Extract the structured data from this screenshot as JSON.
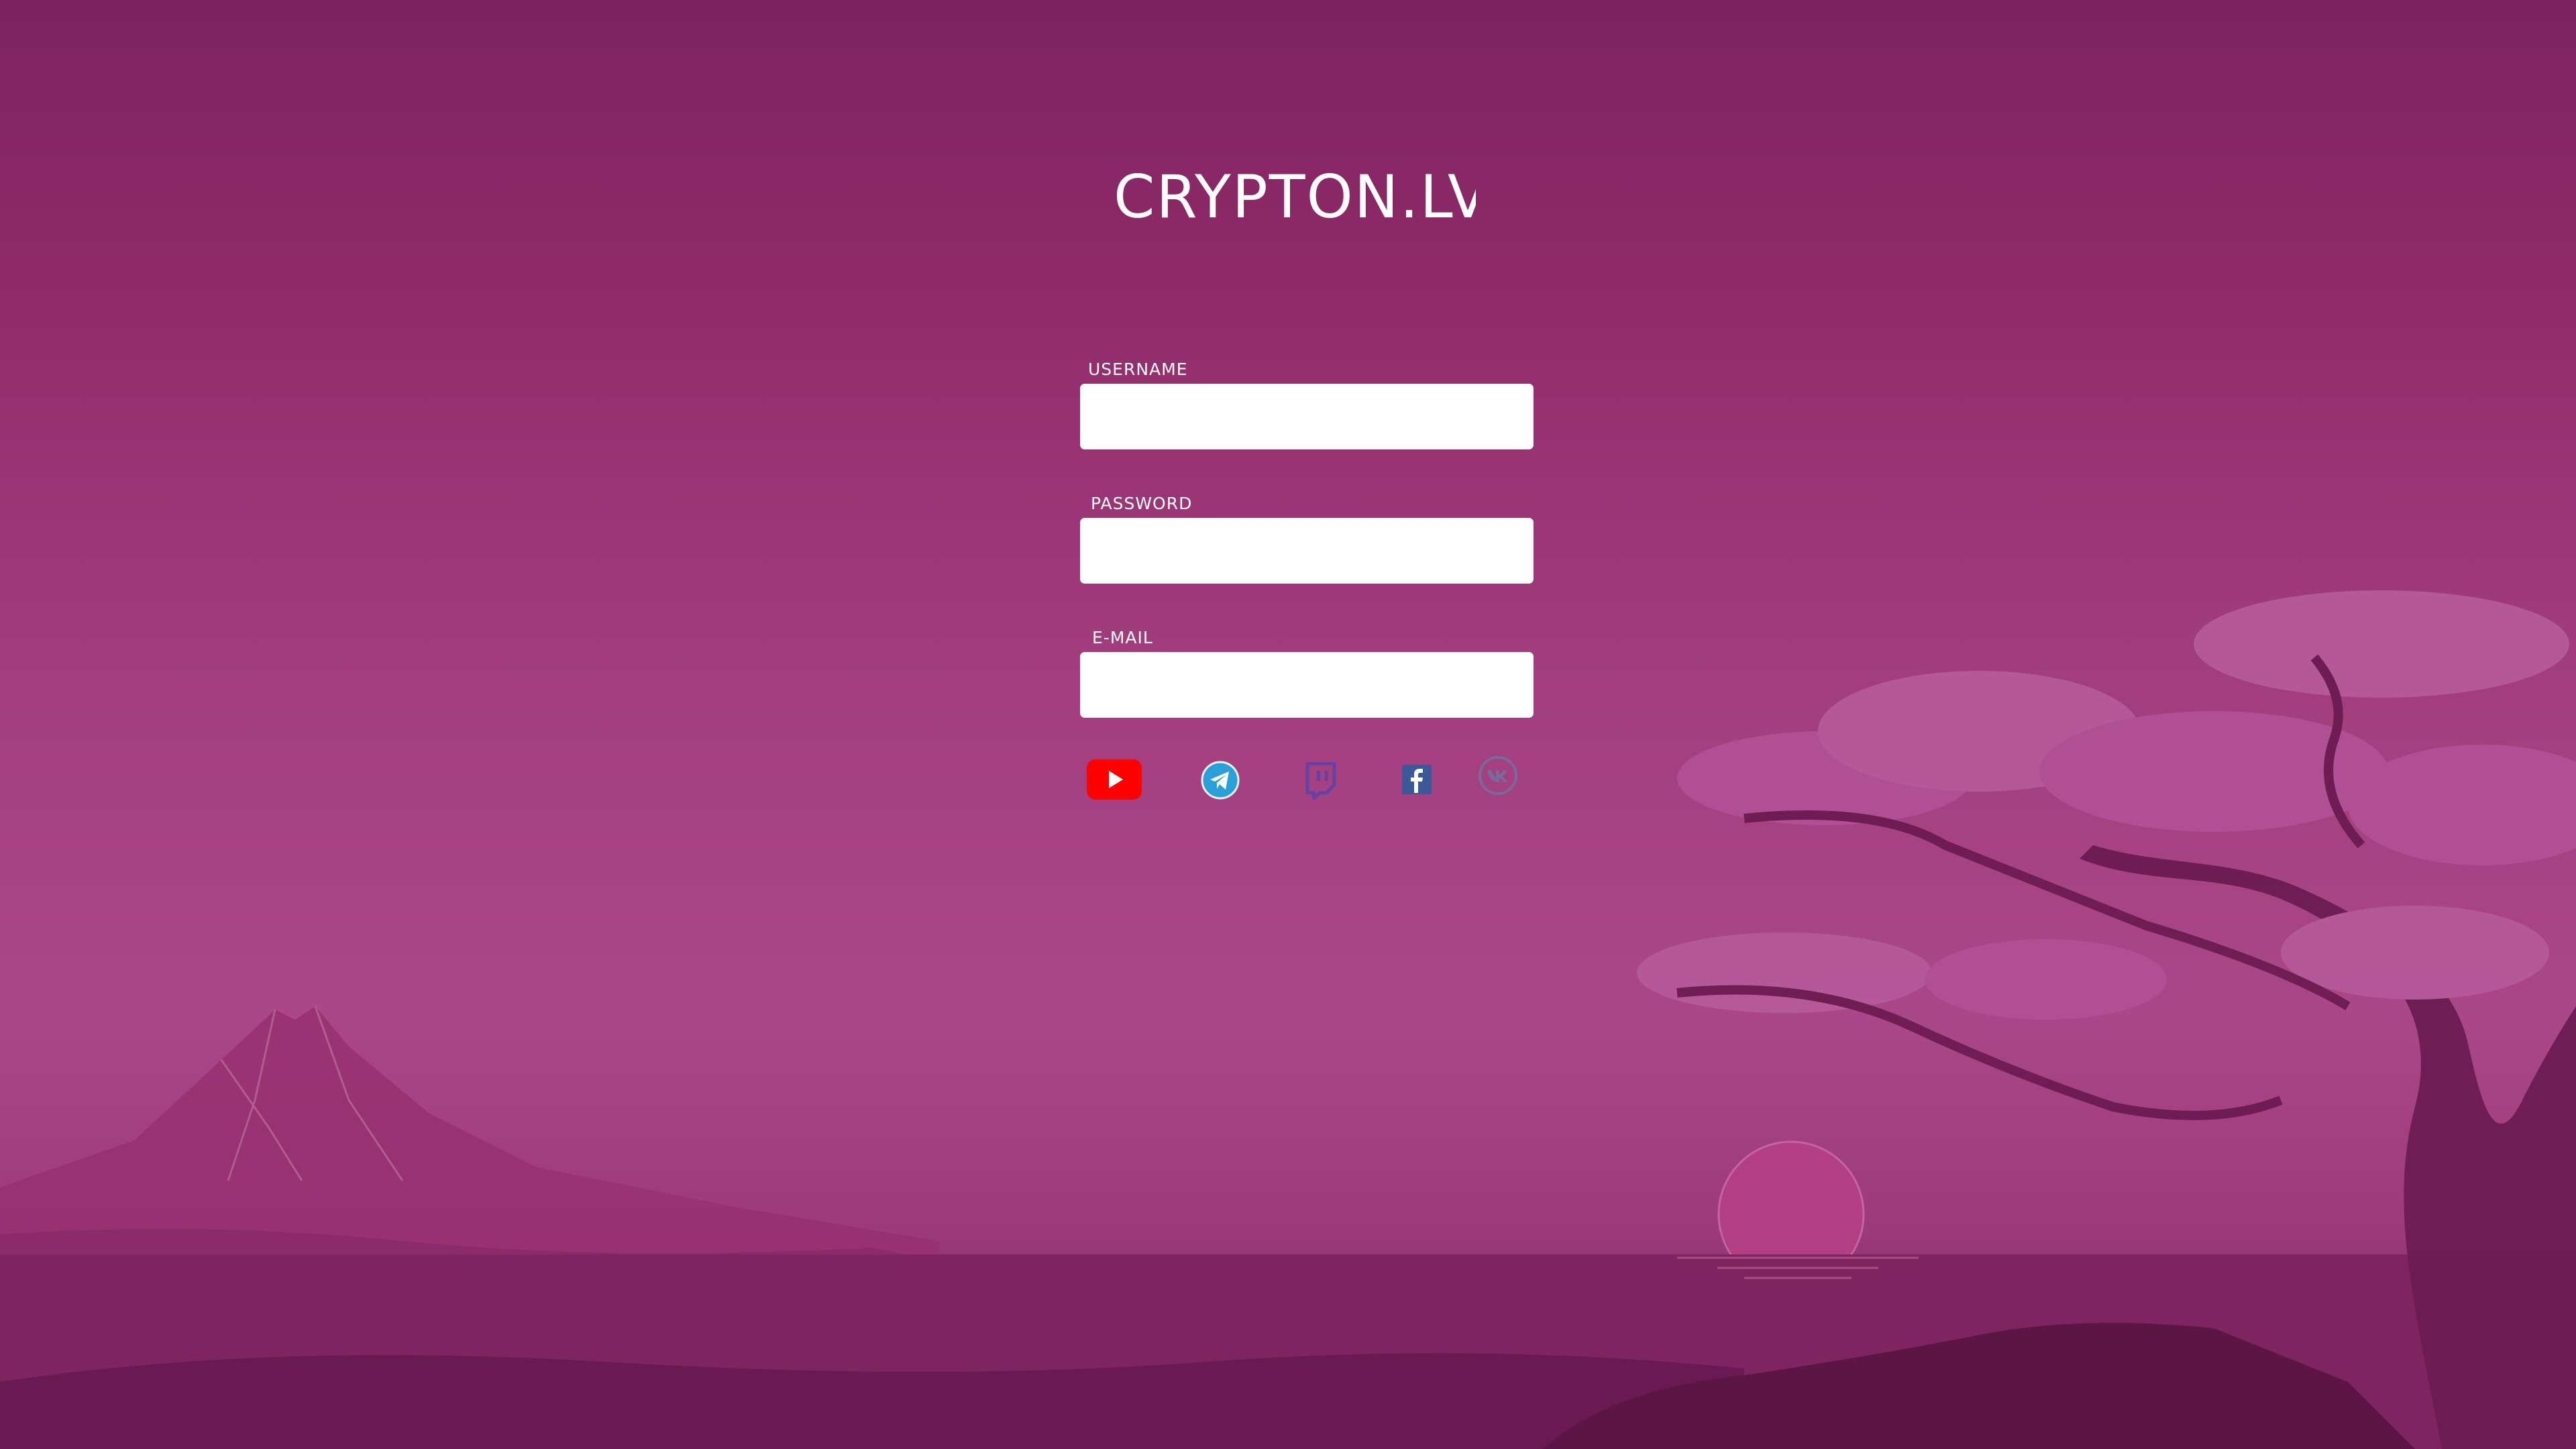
{
  "brand": {
    "name": "CRYPTON.LV"
  },
  "form": {
    "username_label": "USERNAME",
    "username_value": "",
    "password_label": "PASSWORD",
    "password_value": "",
    "email_label": "E-MAIL",
    "email_value": ""
  },
  "socials": [
    {
      "name": "youtube-icon",
      "color": "#ff0000"
    },
    {
      "name": "telegram-icon",
      "color": "#2a9fd8"
    },
    {
      "name": "twitch-icon",
      "color": "#6441a4"
    },
    {
      "name": "facebook-icon",
      "color": "#3b5998"
    },
    {
      "name": "vk-icon",
      "color": "#7a6a9a"
    }
  ],
  "colors": {
    "background_top": "#7c2260",
    "background_mid": "#aa4788",
    "background_bottom": "#6a1a50",
    "input_bg": "#ffffff",
    "label_text": "#ffffff"
  }
}
